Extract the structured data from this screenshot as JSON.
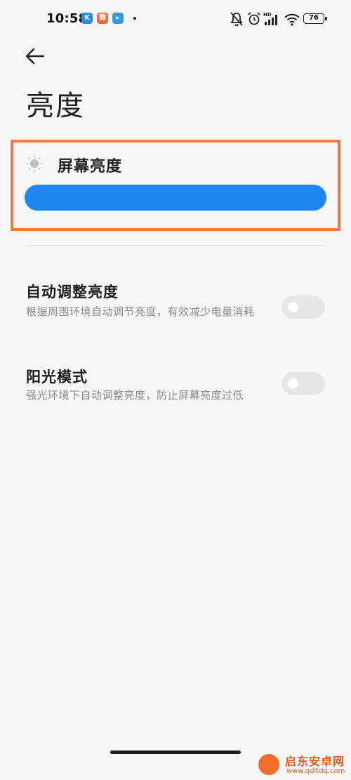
{
  "status_bar": {
    "time": "10:58",
    "app_icons": [
      "K",
      "微",
      "▸"
    ],
    "battery": "76",
    "indicator_icons": [
      "bell-off-icon",
      "alarm-icon",
      "hd-signal-icon",
      "wifi-icon",
      "battery-icon"
    ]
  },
  "header": {
    "back_icon": "back-arrow-icon",
    "title": "亮度"
  },
  "brightness": {
    "icon": "sun-icon",
    "label": "屏幕亮度",
    "level_fraction": 1.0,
    "slider_color": "#2087f0",
    "highlight_color": "#e87a4f"
  },
  "settings": [
    {
      "title": "自动调整亮度",
      "desc": "根据周围环境自动调节亮度，有效减少电量消耗",
      "enabled": false
    },
    {
      "title": "阳光模式",
      "desc": "强光环境下自动调整亮度，防止屏幕亮度过低",
      "enabled": false
    }
  ],
  "watermark": {
    "name": "启东安卓网",
    "url": "www.qdltdq.com"
  }
}
